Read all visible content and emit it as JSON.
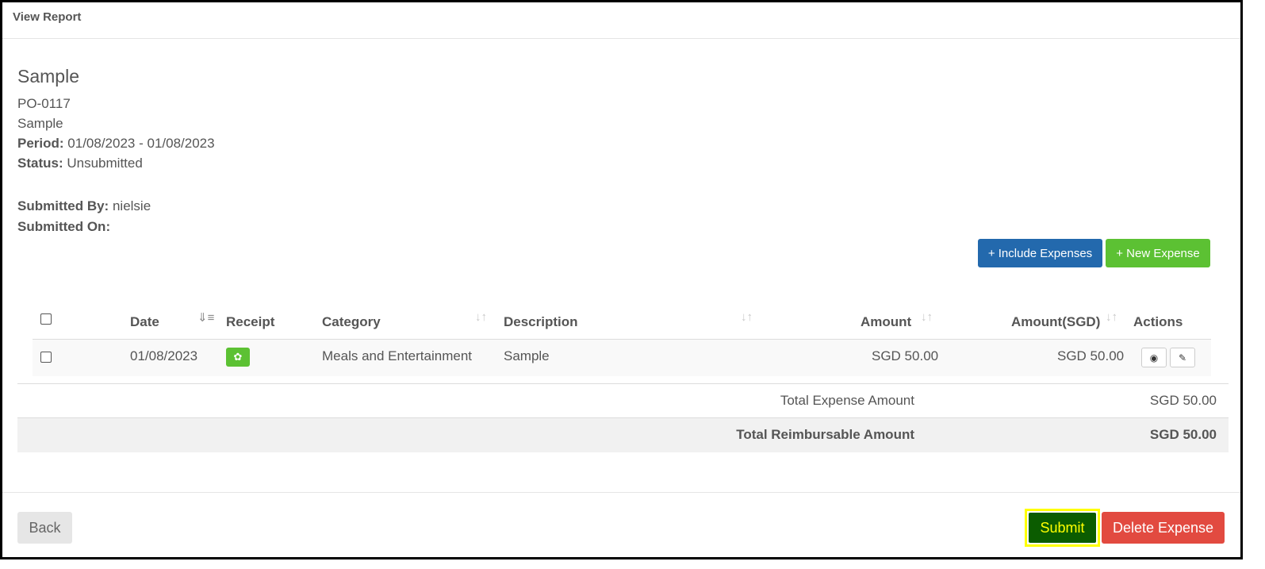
{
  "header": {
    "title": "View Report"
  },
  "report": {
    "title": "Sample",
    "code": "PO-0117",
    "name": "Sample",
    "period_label": "Period:",
    "period_value": "01/08/2023 - 01/08/2023",
    "status_label": "Status:",
    "status_value": "Unsubmitted",
    "submitted_by_label": "Submitted By:",
    "submitted_by_value": "nielsie",
    "submitted_on_label": "Submitted On:"
  },
  "toolbar": {
    "include_label": "+ Include Expenses",
    "new_label": "+ New Expense"
  },
  "table": {
    "columns": {
      "date": "Date",
      "receipt": "Receipt",
      "category": "Category",
      "description": "Description",
      "amount": "Amount",
      "amount_sgd": "Amount(SGD)",
      "actions": "Actions"
    },
    "rows": [
      {
        "date": "01/08/2023",
        "category": "Meals and Entertainment",
        "description": "Sample",
        "amount": "SGD 50.00",
        "amount_sgd": "SGD 50.00"
      }
    ]
  },
  "summary": {
    "total_expense_label": "Total Expense Amount",
    "total_expense_value": "SGD 50.00",
    "total_reimbursable_label": "Total Reimbursable Amount",
    "total_reimbursable_value": "SGD 50.00"
  },
  "footer": {
    "back_label": "Back",
    "submit_label": "Submit",
    "delete_label": "Delete Expense"
  },
  "icons": {
    "sort": "sort-icon",
    "receipt": "paperclip-icon",
    "view": "eye-icon",
    "edit": "pencil-icon"
  },
  "colors": {
    "include_button": "#2369ad",
    "new_button": "#5cc133",
    "submit_button": "#0b5c00",
    "submit_text": "#ffff00",
    "submit_highlight": "#ffff00",
    "delete_button": "#e24a40"
  }
}
